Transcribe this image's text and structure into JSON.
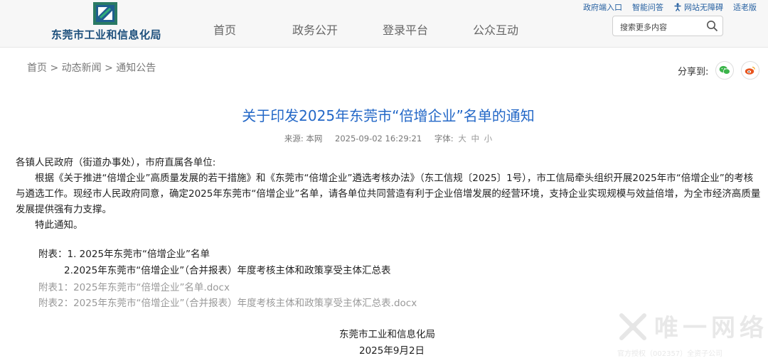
{
  "header": {
    "logo_text": "东莞市工业和信息化局",
    "nav": [
      "首页",
      "政务公开",
      "登录平台",
      "公众互动"
    ],
    "top_links": {
      "gov_portal": "政府端入口",
      "smart_qa": "智能问答",
      "accessibility": "网站无障碍",
      "elder_mode": "适老版"
    },
    "search": {
      "placeholder": "搜索更多内容",
      "value": ""
    }
  },
  "breadcrumb": [
    "首页",
    ">",
    "动态新闻",
    ">",
    "通知公告"
  ],
  "share": {
    "label": "分享到:",
    "targets": [
      "wechat-icon",
      "weibo-icon"
    ]
  },
  "article": {
    "title": "关于印发2025年东莞市“倍增企业”名单的通知",
    "source_label": "来源:",
    "source": "本网",
    "datetime": "2025-09-02 16:29:21",
    "font_label": "字体:",
    "font_sizes": [
      "大",
      "中",
      "小"
    ],
    "salutation": "各镇人民政府（街道办事处），市府直属各单位:",
    "paragraph": "根据《关于推进“倍增企业”高质量发展的若干措施》和《东莞市“倍增企业”遴选考核办法》（东工信规〔2025〕1号），市工信局牵头组织开展2025年市“倍增企业”的考核与遴选工作。现经市人民政府同意，确定2025年东莞市“倍增企业”名单，请各单位共同营造有利于企业倍增发展的经营环境，支持企业实现规模与效益倍增，为全市经济高质量发展提供强有力支撑。",
    "closing": "特此通知。",
    "attachments_intro": "附表：1. 2025年东莞市“倍增企业”名单",
    "attachments_second": "2.2025年东莞市“倍增企业”（合并报表）年度考核主体和政策享受主体汇总表",
    "attachment_links": [
      "附表1：2025年东莞市“倍增企业”名单.docx",
      "附表2：2025年东莞市“倍增企业”（合并报表）年度考核主体和政策享受主体汇总表.docx"
    ],
    "signature": "东莞市工业和信息化局",
    "date": "2025年9月2日"
  },
  "watermark": {
    "title": "唯一网络",
    "subtitle": "官方授权（002357）全资子公司"
  },
  "colors": {
    "title_blue": "#2468c7",
    "link_grey": "#999999",
    "logo_blue": "#1c4f7c",
    "wechat_green": "#3bb44a",
    "weibo_orange": "#e8541e"
  }
}
